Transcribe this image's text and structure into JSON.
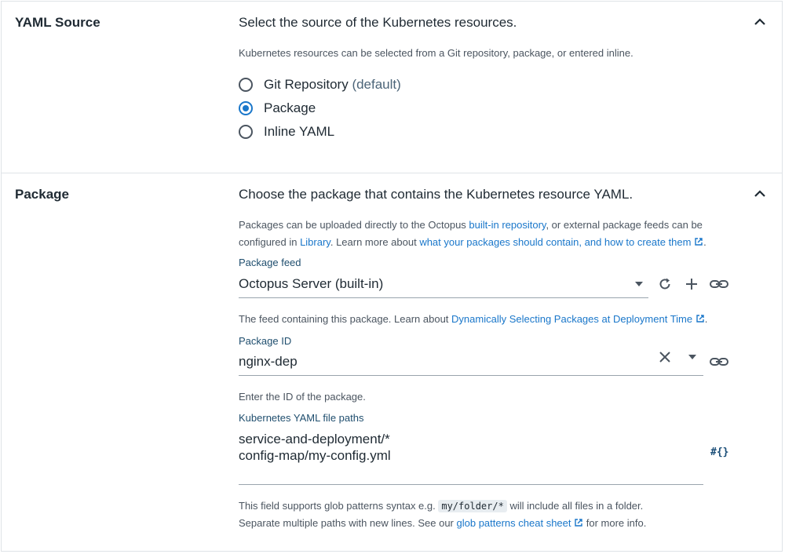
{
  "yaml_source": {
    "title": "YAML Source",
    "heading": "Select the source of the Kubernetes resources.",
    "description": "Kubernetes resources can be selected from a Git repository, package, or entered inline.",
    "options": [
      {
        "label": "Git Repository",
        "suffix": "(default)",
        "selected": false
      },
      {
        "label": "Package",
        "suffix": "",
        "selected": true
      },
      {
        "label": "Inline YAML",
        "suffix": "",
        "selected": false
      }
    ]
  },
  "package": {
    "title": "Package",
    "heading": "Choose the package that contains the Kubernetes resource YAML.",
    "desc_part1": "Packages can be uploaded directly to the Octopus ",
    "desc_link1": "built-in repository",
    "desc_part2": ", or external package feeds can be",
    "desc_part3": "configured in ",
    "desc_link2": "Library",
    "desc_part4": ". Learn more about ",
    "desc_link3": "what your packages should contain, and how to create them",
    "desc_part5": ".",
    "feed": {
      "label": "Package feed",
      "value": "Octopus Server (built-in)",
      "help_part1": "The feed containing this package. Learn about ",
      "help_link": "Dynamically Selecting Packages at Deployment Time",
      "help_part2": "."
    },
    "package_id": {
      "label": "Package ID",
      "value": "nginx-dep",
      "help": "Enter the ID of the package."
    },
    "yaml_paths": {
      "label": "Kubernetes YAML file paths",
      "line1": "service-and-deployment/*",
      "line2": "config-map/my-config.yml",
      "variable_icon": "#{}",
      "help_part1": "This field supports glob patterns syntax e.g. ",
      "help_code": "my/folder/*",
      "help_part2": " will include all files in a folder.",
      "help_part3": "Separate multiple paths with new lines. See our ",
      "help_link": "glob patterns cheat sheet",
      "help_part4": " for more info."
    }
  },
  "colors": {
    "accent": "#1a77ca",
    "text": "#1f2a33",
    "muted": "#4b5560",
    "border": "#dfe3e7"
  }
}
